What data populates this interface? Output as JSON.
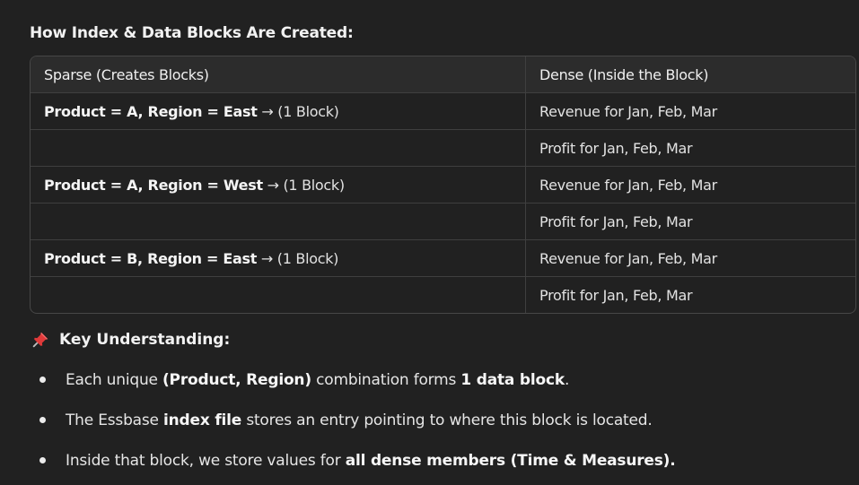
{
  "heading": "How Index & Data Blocks Are Created:",
  "table": {
    "headers": [
      "Sparse (Creates Blocks)",
      "Dense (Inside the Block)"
    ],
    "rows": [
      {
        "sparse_bold": "Product = A, Region = East",
        "sparse_rest": " → (1 Block)",
        "dense": "Revenue for Jan, Feb, Mar"
      },
      {
        "sparse_bold": "",
        "sparse_rest": "",
        "dense": "Profit for Jan, Feb, Mar"
      },
      {
        "sparse_bold": "Product = A, Region = West",
        "sparse_rest": " → (1 Block)",
        "dense": "Revenue for Jan, Feb, Mar"
      },
      {
        "sparse_bold": "",
        "sparse_rest": "",
        "dense": "Profit for Jan, Feb, Mar"
      },
      {
        "sparse_bold": "Product = B, Region = East",
        "sparse_rest": " → (1 Block)",
        "dense": "Revenue for Jan, Feb, Mar"
      },
      {
        "sparse_bold": "",
        "sparse_rest": "",
        "dense": "Profit for Jan, Feb, Mar"
      }
    ]
  },
  "key_section": {
    "icon": "pushpin-icon",
    "title": "Key Understanding:"
  },
  "points": [
    {
      "a": "Each unique ",
      "b": "(Product, Region)",
      "c": " combination forms ",
      "d": "1 data block",
      "e": "."
    },
    {
      "a": "The Essbase ",
      "b": "index file",
      "c": " stores an entry pointing to where this block is located.",
      "d": "",
      "e": ""
    },
    {
      "a": "Inside that block, we store values for ",
      "b": "all dense members (Time & Measures).",
      "c": "",
      "d": "",
      "e": ""
    }
  ],
  "colors": {
    "background": "#212121",
    "header_row": "#2c2c2c",
    "border": "#474747",
    "pin_red": "#e03a3a"
  }
}
